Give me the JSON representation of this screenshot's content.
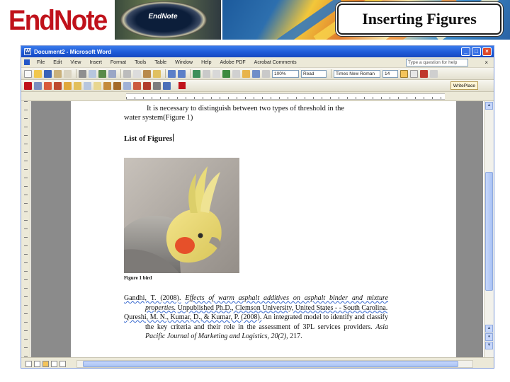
{
  "slide": {
    "logo_text": "EndNote",
    "logo_tm": "®",
    "gauge_label": "EndNote",
    "title": "Inserting Figures"
  },
  "window": {
    "title": "Document2 - Microsoft Word",
    "controls": [
      "_",
      "□",
      "×"
    ]
  },
  "menu": {
    "items": [
      "File",
      "Edit",
      "View",
      "Insert",
      "Format",
      "Tools",
      "Table",
      "Window",
      "Help",
      "Adobe PDF",
      "Acrobat Comments"
    ],
    "help_placeholder": "Type a question for help",
    "close": "×"
  },
  "toolbar": {
    "zoom": "100%",
    "read_label": "Read",
    "font": "Times New Roman",
    "font_size": "14",
    "endnote_label": "WritePlace"
  },
  "document": {
    "intro_line1": "It is necessary to distinguish between two types of threshold in the",
    "intro_line2": "water system(Figure 1)",
    "list_of_figures": "List of Figures",
    "figure_caption": "Figure 1 bird",
    "references": [
      {
        "authors": "Gandhi, T. (2008).",
        "title": "Effects of warm asphalt additives on asphalt binder and mixture properties.",
        "source": "Unpublished Ph.D., Clemson University, United States - - South Carolina."
      },
      {
        "authors": "Qureshi, M. N., Kumar, D., & Kumar, P. (2008).",
        "title_plain": "An integrated model to identify and classify the key criteria and their role in the assessment of 3PL services providers.",
        "journal": "Asia Pacific Journal of Marketing and Logistics, 20(2),",
        "pages": "217."
      }
    ]
  }
}
